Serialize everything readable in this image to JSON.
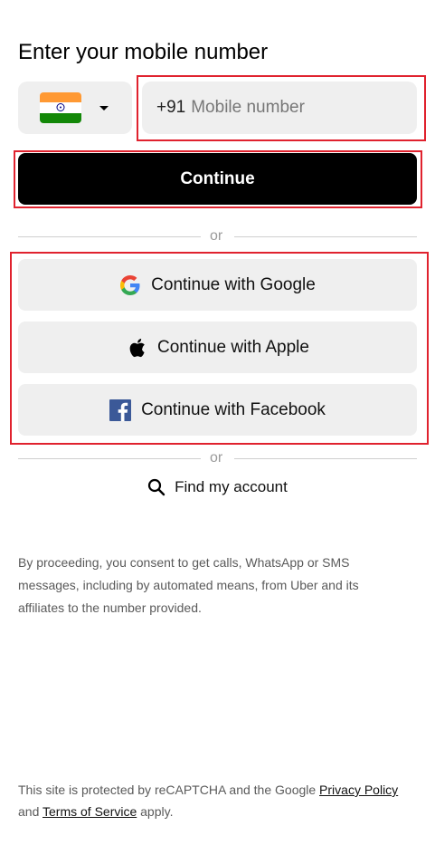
{
  "title": "Enter your mobile number",
  "country": {
    "flag_colors": [
      "#FF9933",
      "#FFFFFF",
      "#138808"
    ],
    "chakra_color": "#000080"
  },
  "phone": {
    "prefix": "+91",
    "placeholder": "Mobile number",
    "value": ""
  },
  "continue_label": "Continue",
  "divider_text": "or",
  "social": {
    "google_label": "Continue with Google",
    "apple_label": "Continue with Apple",
    "facebook_label": "Continue with Facebook"
  },
  "find_account_label": "Find my account",
  "consent_text": "By proceeding, you consent to get calls, WhatsApp or SMS messages, including by automated means, from Uber and its affiliates to the number provided.",
  "footer": {
    "part1": "This site is protected by reCAPTCHA and the Google ",
    "privacy_link": "Privacy Policy",
    "part2": " and ",
    "terms_link": "Terms of Service",
    "part3": " apply."
  },
  "colors": {
    "highlight": "#e0222e",
    "primary_button": "#000000",
    "button_bg": "#efefef"
  }
}
